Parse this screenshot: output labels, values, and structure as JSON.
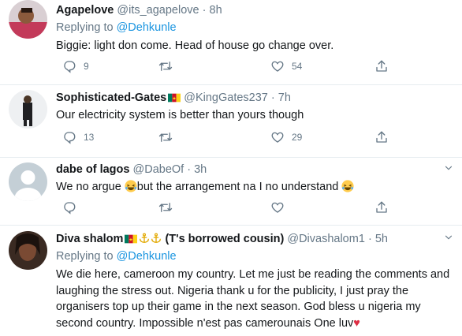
{
  "tweets": [
    {
      "name": "Agapelove",
      "handle": "@its_agapelove",
      "time": "8h",
      "reply_prefix": "Replying to",
      "reply_to": "@Dehkunle",
      "text": "Biggie: light don come. Head of house go change over.",
      "replies": "9",
      "retweets": "",
      "likes": "54"
    },
    {
      "name": "Sophisticated-Gates",
      "handle": "@KingGates237",
      "time": "7h",
      "text": "Our electricity system is better than yours though",
      "replies": "13",
      "retweets": "",
      "likes": "29"
    },
    {
      "name": "dabe of lagos",
      "handle": "@DabeOf",
      "time": "3h",
      "text_a": "We no argue",
      "text_b": "but the arrangement na I no understand",
      "replies": "",
      "retweets": "",
      "likes": ""
    },
    {
      "name_a": "Diva shalom",
      "name_b": "(T's borrowed cousin)",
      "handle": "@Divashalom1",
      "time": "5h",
      "reply_prefix": "Replying to",
      "reply_to": "@Dehkunle",
      "text": "We die here, cameroon my country. Let me just be reading the comments and laughing the stress out. Nigeria thank u for the publicity, I just pray the organisers top up their game in the next season. God bless u nigeria my second country. Impossible n'est pas camerounais One luv",
      "heart": "♥"
    }
  ],
  "separator": "·",
  "colors": {
    "link": "#1b95e0",
    "muted": "#657786",
    "text": "#14171a",
    "heart": "#e0245e",
    "divider": "#e6ecf0"
  },
  "icons": [
    "reply-icon",
    "retweet-icon",
    "like-icon",
    "share-icon",
    "caret-down-icon",
    "cameroon-flag-icon",
    "laughing-emoji-icon",
    "anchor-icon",
    "red-heart-icon"
  ]
}
